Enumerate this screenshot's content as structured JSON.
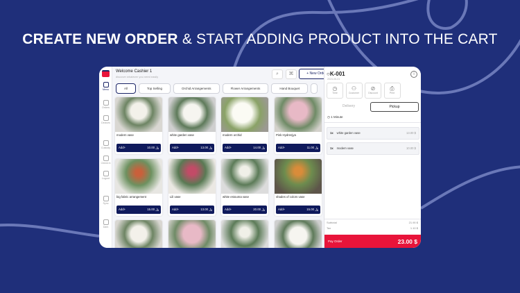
{
  "headline": {
    "bold": "CREATE NEW ORDER",
    "rest": " & START ADDING PRODUCT INTO THE CART"
  },
  "sidebar": [
    {
      "label": "Menu",
      "active": true
    },
    {
      "label": "Orders"
    },
    {
      "label": "Devices"
    },
    {
      "label": "Custody"
    },
    {
      "label": "Check in"
    },
    {
      "label": "Logout"
    },
    {
      "label": "Sync"
    },
    {
      "label": "Dark"
    }
  ],
  "header": {
    "welcome": "Welcome Cashier 1",
    "subtitle": "discover whatever you need easily",
    "new_order": "+ New Order"
  },
  "categories": [
    "All",
    "Top Selling",
    "Orchid Arrangements",
    "Flower Arrangements",
    "Hand Bouquet"
  ],
  "add_label": "Add+",
  "products": [
    {
      "name": "modern vase",
      "price": "10.00 ﷼"
    },
    {
      "name": "white garden vase",
      "price": "13.00 ﷼"
    },
    {
      "name": "modern orchid",
      "price": "14.00 ﷼"
    },
    {
      "name": "Pink Hydrenjya",
      "price": "11.00 ﷼"
    },
    {
      "name": "big fabric arrangement",
      "price": "15.00 ﷼"
    },
    {
      "name": "Lili vase",
      "price": "13.00 ﷼"
    },
    {
      "name": "white estouma vase",
      "price": "20.00 ﷼"
    },
    {
      "name": "shades of colors vase",
      "price": "15.00 ﷼"
    }
  ],
  "order": {
    "id": "K-001",
    "date": "2024-06-01",
    "actions": [
      "Time",
      "Customer",
      "Discount",
      "Print"
    ],
    "tabs": [
      "Delivery",
      "Pickup"
    ],
    "time": "1 Minute",
    "items": [
      {
        "qty": "1x",
        "name": "white garden vase",
        "price": "13.00 $"
      },
      {
        "qty": "1x",
        "name": "modern vase",
        "price": "10.00 $"
      }
    ],
    "subtotal_label": "Subtotal",
    "subtotal": "21.90 $",
    "tax_label": "Tax",
    "tax": "1.10 $",
    "pay_label": "Pay Order",
    "total": "23.00 $"
  },
  "colors": {
    "background": "#1f2f7a",
    "primary": "#0f1a5c",
    "pay": "#e8143a"
  }
}
